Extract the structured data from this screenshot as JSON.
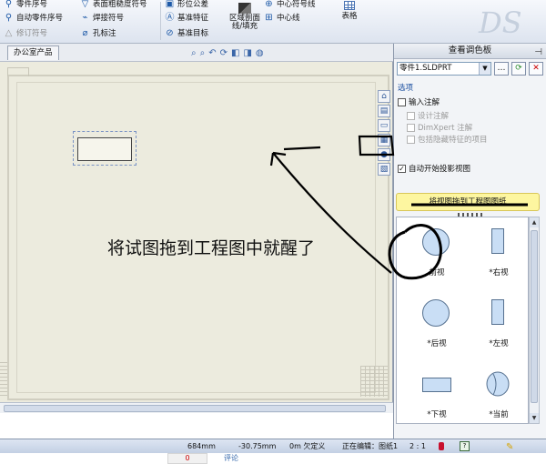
{
  "ribbon": {
    "col1": [
      "零件序号",
      "自动零件序号",
      "修订符号"
    ],
    "col2": [
      "表面粗糙度符号",
      "焊接符号",
      "孔标注"
    ],
    "col3": [
      "形位公差",
      "基准特征",
      "基准目标"
    ],
    "region_label": "区域剖面线/填充",
    "col5": [
      "中心符号线",
      "中心线"
    ],
    "table_label": "表格"
  },
  "tabs": {
    "active": "办公室产品"
  },
  "annotation": "将试图拖到工程图中就醒了",
  "pane": {
    "title": "查看调色板",
    "model": "零件1.SLDPRT",
    "options_label": "选项",
    "input_annotation": "输入注解",
    "design_annotation": "设计注解",
    "dimxpert_annotation": "DimXpert 注解",
    "include_hidden": "包括隐藏特征的项目",
    "auto_projected": "自动开始投影视图",
    "drag_hint": "将视图拖到工程图图纸",
    "views": [
      "前视",
      "*右视",
      "*后视",
      "*左视",
      "*下视",
      "*当前"
    ]
  },
  "status": {
    "x": "684mm",
    "y": "-30.75mm",
    "z": "0m 欠定义",
    "editing": "正在编辑：图纸1",
    "scale": "2 : 1"
  },
  "footer": {
    "count": "0",
    "comment": "评论"
  },
  "colors": {
    "highlight": "#fdf6a0",
    "accent": "#1b4fa0"
  }
}
